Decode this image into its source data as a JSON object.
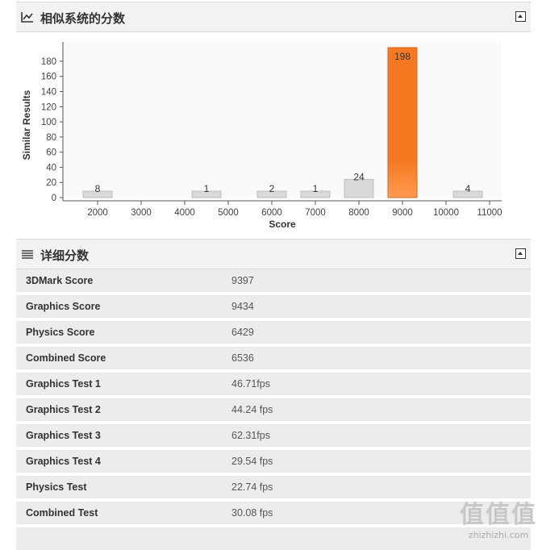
{
  "section1": {
    "title": "相似系统的分数"
  },
  "section2": {
    "title": "详细分数"
  },
  "chart_data": {
    "type": "bar",
    "xlabel": "Score",
    "ylabel": "Similar Results",
    "ylim": [
      0,
      198
    ],
    "yticks": [
      0,
      20,
      40,
      60,
      80,
      100,
      120,
      140,
      160,
      180
    ],
    "xticks": [
      "2000",
      "3000",
      "4000",
      "5000",
      "6000",
      "7000",
      "8000",
      "9000",
      "10000",
      "11000"
    ],
    "categories": [
      "2000",
      "4500",
      "6000",
      "7000",
      "8000",
      "9000",
      "10500"
    ],
    "values": [
      8,
      1,
      2,
      1,
      24,
      198,
      4
    ],
    "highlight_index": 5,
    "colors": {
      "bar": "#d9d9d9",
      "highlight": "#f47920",
      "axis": "#555555"
    }
  },
  "details": [
    {
      "label": "3DMark Score",
      "value": "9397"
    },
    {
      "label": "Graphics Score",
      "value": "9434"
    },
    {
      "label": "Physics Score",
      "value": "6429"
    },
    {
      "label": "Combined Score",
      "value": "6536"
    },
    {
      "label": "Graphics Test 1",
      "value": "46.71fps"
    },
    {
      "label": "Graphics Test 2",
      "value": "44.24 fps"
    },
    {
      "label": "Graphics Test 3",
      "value": "62.31fps"
    },
    {
      "label": "Graphics Test 4",
      "value": "29.54 fps"
    },
    {
      "label": "Physics Test",
      "value": "22.74 fps"
    },
    {
      "label": "Combined Test",
      "value": "30.08 fps"
    }
  ],
  "watermark": {
    "glyphs": "值值值",
    "site": "zhizhizhi.com"
  }
}
